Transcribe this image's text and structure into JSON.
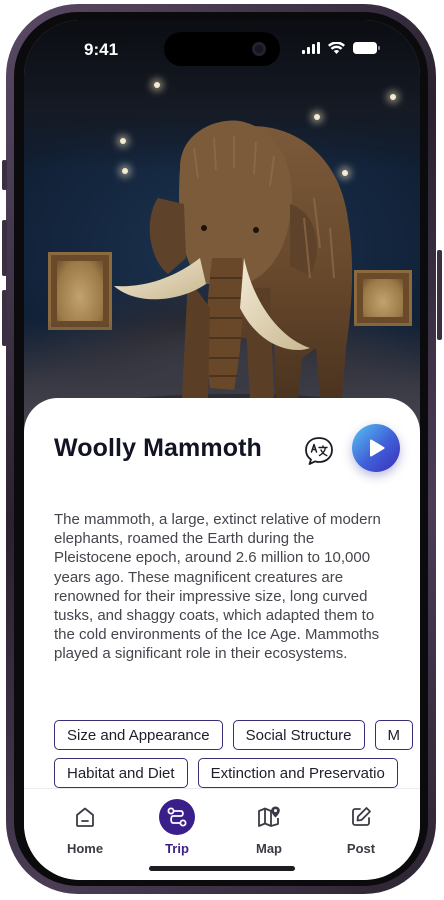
{
  "status_bar": {
    "time": "9:41"
  },
  "exhibit": {
    "title": "Woolly Mammoth",
    "description": "The mammoth, a large, extinct relative of modern elephants, roamed the Earth during the Pleistocene epoch, around 2.6 million to 10,000 years ago. These magnificent creatures are renowned for their impressive size, long curved tusks, and shaggy coats, which adapted them to the cold environments of the Ice Age. Mammoths played a significant role in their ecosystems.",
    "translate_icon": "translate-icon",
    "play_icon": "play-icon"
  },
  "topics": {
    "row1": [
      "Size and Appearance",
      "Social Structure",
      "M"
    ],
    "row2": [
      "Habitat and Diet",
      "Extinction and Preservatio"
    ]
  },
  "nav": {
    "items": [
      {
        "label": "Home",
        "icon": "home-icon"
      },
      {
        "label": "Trip",
        "icon": "route-icon"
      },
      {
        "label": "Map",
        "icon": "map-pin-icon"
      },
      {
        "label": "Post",
        "icon": "edit-icon"
      }
    ],
    "active": "Trip"
  },
  "colors": {
    "accent": "#3a1f8a",
    "chip_border": "#3b2e78",
    "title": "#121423",
    "play_gradient_start": "#58c4f0",
    "play_gradient_end": "#3b2fb8"
  }
}
